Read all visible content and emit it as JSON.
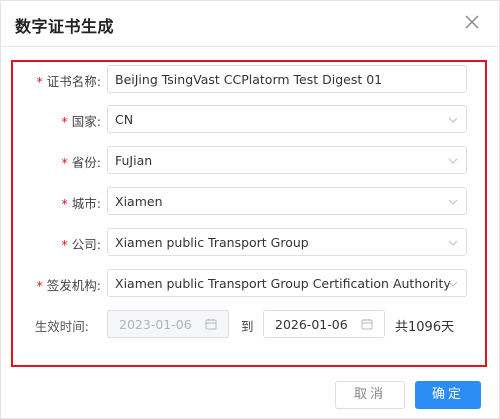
{
  "dialog": {
    "title": "数字证书生成",
    "close_icon": "close-icon"
  },
  "form": {
    "cert_name": {
      "label": "证书名称:",
      "value": "BeiJing TsingVast CCPlatorm Test Digest 01",
      "required": true
    },
    "country": {
      "label": "国家:",
      "value": "CN",
      "required": true
    },
    "province": {
      "label": "省份:",
      "value": "FuJian",
      "required": true
    },
    "city": {
      "label": "城市:",
      "value": "Xiamen",
      "required": true
    },
    "company": {
      "label": "公司:",
      "value": "Xiamen public Transport Group",
      "required": true
    },
    "issuer": {
      "label": "签发机构:",
      "value": "Xiamen public Transport Group Certification Authority",
      "required": true
    },
    "validity": {
      "label": "生效时间:",
      "start": "2023-01-06",
      "separator": "到",
      "end": "2026-01-06",
      "total": "共1096天"
    },
    "required_mark": "*"
  },
  "footer": {
    "cancel_label": "取消",
    "ok_label": "确定"
  },
  "colors": {
    "required_star": "#e0141e",
    "highlight_border": "#e0141e",
    "primary": "#2b8cf6"
  }
}
